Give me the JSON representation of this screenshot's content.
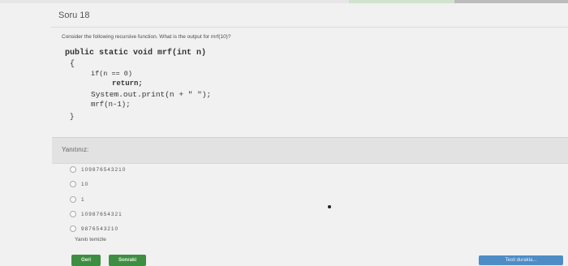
{
  "question": {
    "title": "Soru 18",
    "prompt": "Consider the following recursive function. What is the output for mrf(10)?"
  },
  "code": {
    "lines": [
      "public static void mrf(int n)",
      "{",
      "if(n == 0)",
      "return;",
      "System.out.print(n + \" \");",
      "mrf(n-1);",
      "}"
    ]
  },
  "answer": {
    "label": "Yanıtınız:",
    "options": [
      "109876543210",
      "10",
      "1",
      "10987654321",
      "9876543210"
    ],
    "clear_label": "Yanıtı temizle"
  },
  "navigation": {
    "prev_label": "Geri",
    "next_label": "Sonraki",
    "finish_label": "Testi durakla..."
  },
  "colors": {
    "nav_button": "#3e8e41",
    "finish_button": "#4e8cc6"
  }
}
